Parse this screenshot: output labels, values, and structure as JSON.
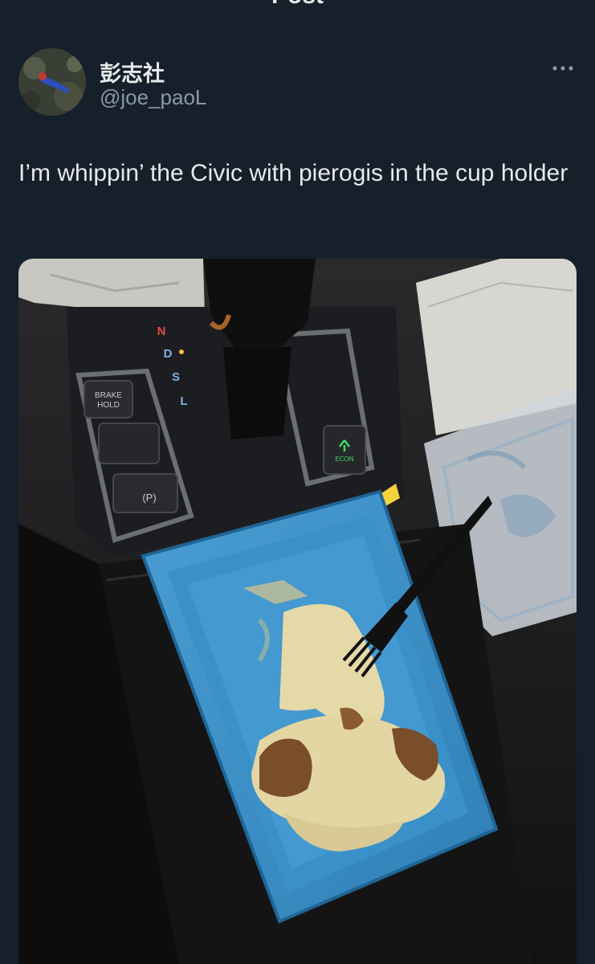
{
  "header": {
    "title": "Post",
    "back_icon": "arrow-left-icon"
  },
  "author": {
    "display_name": "彭志社",
    "handle": "@joe_paoL",
    "avatar_icon": "avatar-photo"
  },
  "more_icon": "more-horizontal-icon",
  "tweet": {
    "text": "I’m whippin’ the Civic with pierogis in the cup holder"
  },
  "media": {
    "shifter_labels": [
      "N",
      "D",
      "S",
      "L"
    ],
    "button_brake": "BRAKE\nHOLD",
    "button_econ": "ECON",
    "button_park": "(P)",
    "colors": {
      "container_blue": "#3b8fc4",
      "pierogi": "#e6d9a8",
      "econ_green": "#3ddc6a"
    }
  }
}
